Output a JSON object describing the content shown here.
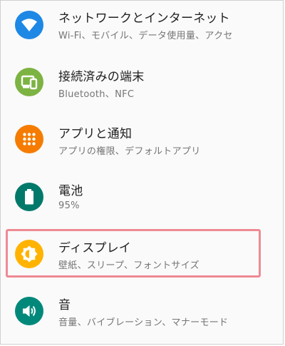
{
  "settings": {
    "items": [
      {
        "title": "ネットワークとインターネット",
        "subtitle": "Wi-Fi、モバイル、データ使用量、アクセ",
        "icon": "wifi-icon",
        "color": "#1e88e5"
      },
      {
        "title": "接続済みの端末",
        "subtitle": "Bluetooth、NFC",
        "icon": "connected-devices-icon",
        "color": "#7cb342"
      },
      {
        "title": "アプリと通知",
        "subtitle": "アプリの権限、デフォルトアプリ",
        "icon": "apps-grid-icon",
        "color": "#f57c00"
      },
      {
        "title": "電池",
        "subtitle": "95%",
        "icon": "battery-icon",
        "color": "#00796b"
      },
      {
        "title": "ディスプレイ",
        "subtitle": "壁紙、スリープ、フォントサイズ",
        "icon": "brightness-icon",
        "color": "#ffb300"
      },
      {
        "title": "音",
        "subtitle": "音量、バイブレーション、マナーモード",
        "icon": "volume-icon",
        "color": "#00897b"
      }
    ],
    "highlighted_index": 4,
    "highlight_color": "#ef8a94"
  }
}
